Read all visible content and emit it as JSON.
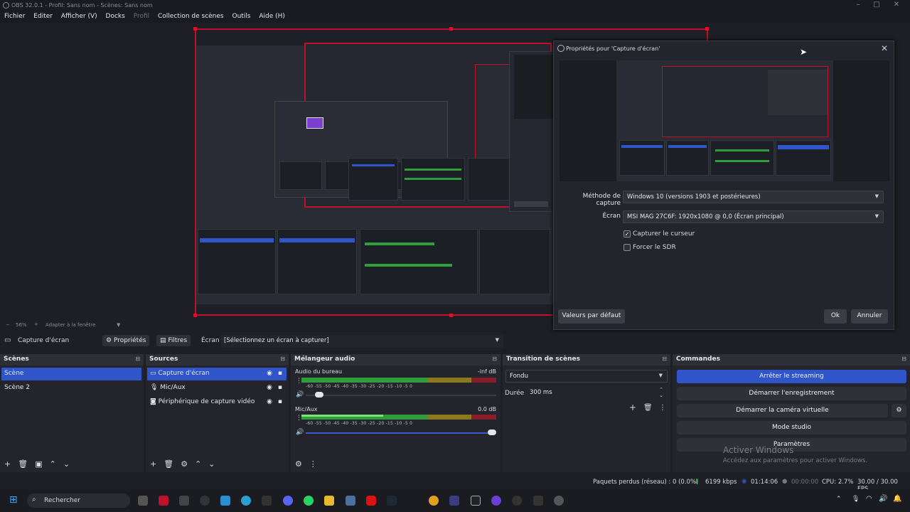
{
  "window": {
    "title": "OBS 32.0.1 - Profil: Sans nom - Scènes: Sans nom"
  },
  "menu": [
    "Fichier",
    "Editer",
    "Afficher (V)",
    "Docks",
    "Profil",
    "Collection de scènes",
    "Outils",
    "Aide (H)"
  ],
  "zoom": {
    "value": "56%",
    "fit_label": "Adapter à la fenêtre"
  },
  "dialog": {
    "title": "Propriétés pour 'Capture d'écran'",
    "method_label": "Méthode de capture",
    "method_value": "Windows 10 (versions 1903 et postérieures)",
    "screen_label": "Écran",
    "screen_value": "MSI MAG 27C6F: 1920x1080 @ 0,0 (Écran principal)",
    "capture_cursor": "Capturer le curseur",
    "capture_cursor_checked": true,
    "force_sdr": "Forcer le SDR",
    "force_sdr_checked": false,
    "defaults": "Valeurs par défaut",
    "ok": "Ok",
    "cancel": "Annuler"
  },
  "toolbar": {
    "source_name": "Capture d'écran",
    "properties": "Propriétés",
    "filters": "Filtres",
    "screen_label": "Écran",
    "screen_value": "[Sélectionnez un écran à capturer]"
  },
  "scenes": {
    "title": "Scènes",
    "items": [
      "Scène",
      "Scène 2"
    ],
    "selected": 0
  },
  "sources": {
    "title": "Sources",
    "items": [
      "Capture d'écran",
      "Mic/Aux",
      "Périphérique de capture vidéo"
    ],
    "selected": 0
  },
  "mixer": {
    "title": "Mélangeur audio",
    "channels": [
      {
        "name": "Audio du bureau",
        "db": "-inf dB",
        "level": 0.0,
        "volume": 0.05
      },
      {
        "name": "Mic/Aux",
        "db": "0.0 dB",
        "level": 0.42,
        "volume": 1.0
      }
    ],
    "ticks": "-60 -55 -50 -45 -40 -35 -30 -25 -20 -15 -10 -5 0"
  },
  "transition": {
    "title": "Transition de scènes",
    "type": "Fondu",
    "duration_label": "Durée",
    "duration": "300 ms"
  },
  "commands": {
    "title": "Commandes",
    "buttons": [
      "Arrêter le streaming",
      "Démarrer l'enregistrement",
      "Démarrer la caméra virtuelle",
      "Mode studio",
      "Paramètres"
    ]
  },
  "status": {
    "dropped": "Paquets perdus (réseau) : 0 (0.0%)",
    "bitrate": "6199 kbps",
    "stream_time": "01:14:06",
    "rec_time": "00:00:00",
    "cpu": "CPU: 2.7%",
    "fps": "30.00 / 30.00 FPS"
  },
  "watermark": {
    "title": "Activer Windows",
    "subtitle": "Accédez aux paramètres pour activer Windows."
  },
  "taskbar": {
    "search": "Rechercher"
  },
  "colors": {
    "accent": "#2f55c8",
    "selection_red": "#c0102a",
    "meter_green": "#2f9e3a"
  }
}
